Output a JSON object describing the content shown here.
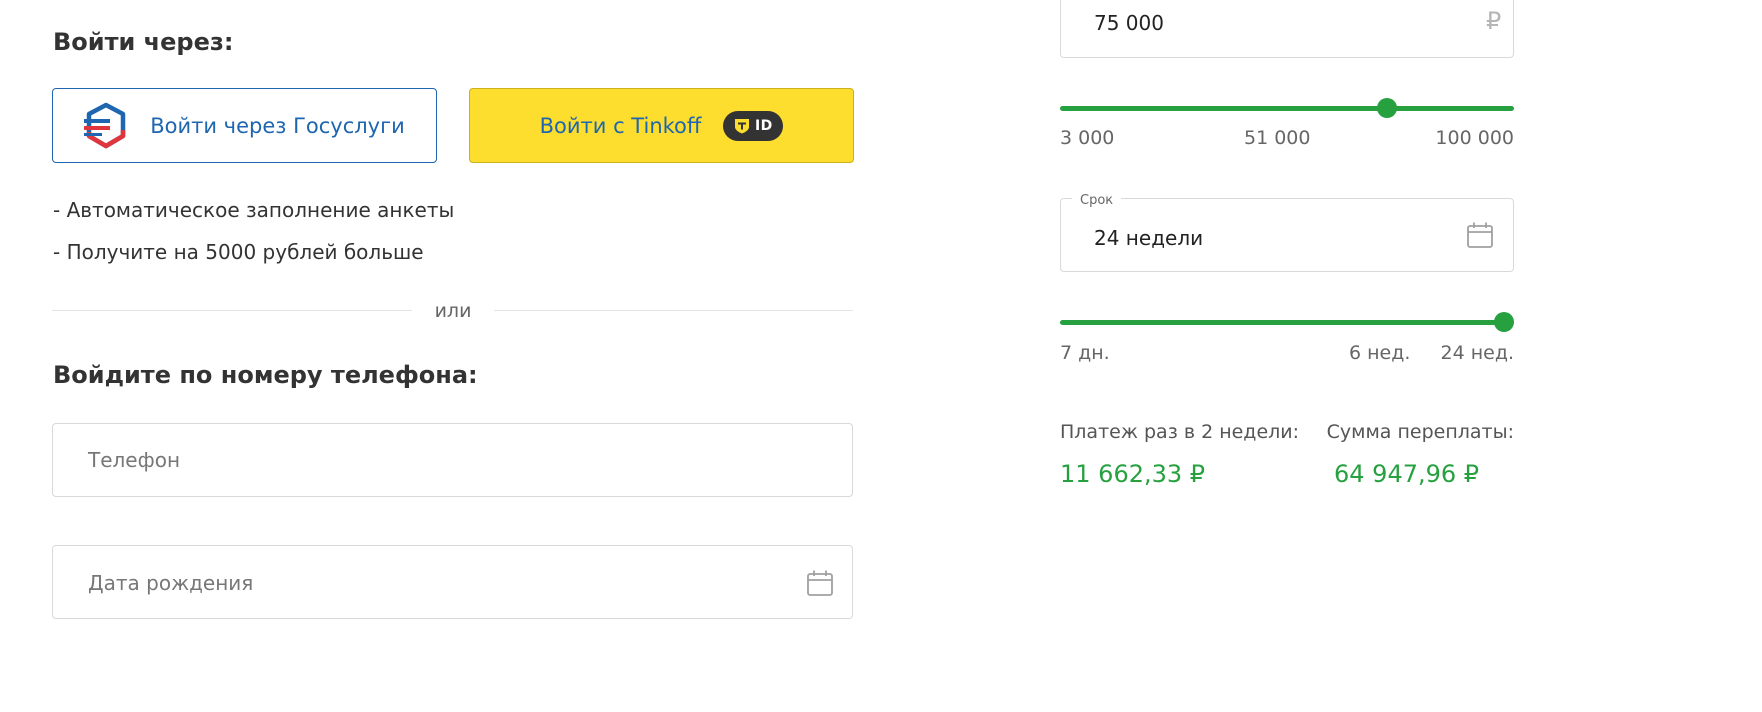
{
  "login": {
    "heading": "Войти через:",
    "gosuslugi_button": "Войти через Госуслуги",
    "tinkoff_button": "Войти с Tinkoff",
    "tinkoff_id_badge": "ID",
    "benefits": [
      "- Автоматическое заполнение анкеты",
      "- Получите на 5000 рублей больше"
    ],
    "divider": "или",
    "phone_heading": "Войдите по номеру телефона:",
    "phone_placeholder": "Телефон",
    "birthdate_placeholder": "Дата рождения"
  },
  "calculator": {
    "amount": {
      "value": "75 000",
      "currency": "₽",
      "slider": {
        "min_label": "3 000",
        "mid_label": "51 000",
        "max_label": "100 000",
        "position_fraction": 0.73
      }
    },
    "term": {
      "label": "Срок",
      "value": "24 недели",
      "slider": {
        "min_label": "7 дн.",
        "mid_label": "6 нед.",
        "max_label": "24 нед.",
        "position_fraction": 1.0
      }
    },
    "payment_label": "Платеж раз в 2 недели:",
    "payment_value": "11 662,33 ₽",
    "overpayment_label": "Сумма переплаты:",
    "overpayment_value": "64 947,96 ₽"
  },
  "colors": {
    "accent_green": "#27a140",
    "gosuslugi_blue": "#1f66b0",
    "tinkoff_yellow": "#fddd2d"
  },
  "icons": [
    "gosuslugi-logo-icon",
    "tinkoff-id-icon",
    "calendar-icon",
    "ruble-icon"
  ]
}
